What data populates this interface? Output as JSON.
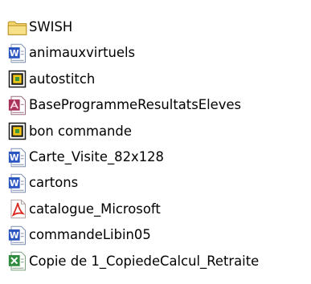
{
  "files": [
    {
      "name": "SWISH",
      "icon": "folder-icon"
    },
    {
      "name": "animauxvirtuels",
      "icon": "word-document-icon"
    },
    {
      "name": "autostitch",
      "icon": "shortcut-app-icon"
    },
    {
      "name": "BaseProgrammeResultatsEleves",
      "icon": "access-database-icon"
    },
    {
      "name": "bon commande",
      "icon": "shortcut-app-icon"
    },
    {
      "name": "Carte_Visite_82x128",
      "icon": "word-document-icon"
    },
    {
      "name": "cartons",
      "icon": "word-document-icon"
    },
    {
      "name": "catalogue_Microsoft",
      "icon": "pdf-document-icon"
    },
    {
      "name": "commandeLibin05",
      "icon": "word-document-icon"
    },
    {
      "name": "Copie de 1_CopiedeCalcul_Retraite",
      "icon": "excel-spreadsheet-icon"
    }
  ],
  "colors": {
    "folder": "#f2d56b",
    "word": "#2b55c0",
    "excel": "#2e8b3e",
    "pdf": "#d9261c",
    "access": "#a8325a",
    "shortcut": "#f0c419"
  }
}
